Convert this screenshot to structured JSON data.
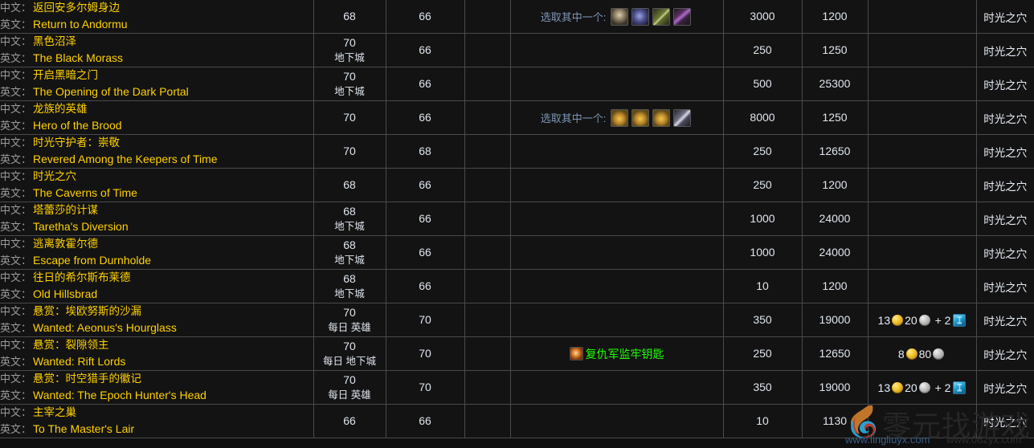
{
  "labels": {
    "chinese": "中文：",
    "english": "英文：",
    "choose_one": "选取其中一个:"
  },
  "rows": [
    {
      "name_zh": "返回安多尔姆身边",
      "name_en": "Return to Andormu",
      "quest_level": "68",
      "quest_tag": "",
      "required_level": "66",
      "item_required": "",
      "choose_one": true,
      "choice_icons": [
        "ic-a",
        "ic-b",
        "ic-c",
        "ic-d"
      ],
      "reputation": "3000",
      "experience": "1200",
      "money": null,
      "zone": "时光之穴"
    },
    {
      "name_zh": "黑色沼泽",
      "name_en": "The Black Morass",
      "quest_level": "70",
      "quest_tag": "地下城",
      "required_level": "66",
      "item_required": "",
      "choose_one": false,
      "choice_icons": [],
      "reputation": "250",
      "experience": "1250",
      "money": null,
      "zone": "时光之穴"
    },
    {
      "name_zh": "开启黑暗之门",
      "name_en": "The Opening of the Dark Portal",
      "quest_level": "70",
      "quest_tag": "地下城",
      "required_level": "66",
      "item_required": "",
      "choose_one": false,
      "choice_icons": [],
      "reputation": "500",
      "experience": "25300",
      "money": null,
      "zone": "时光之穴"
    },
    {
      "name_zh": "龙族的英雄",
      "name_en": "Hero of the Brood",
      "quest_level": "70",
      "quest_tag": "",
      "required_level": "66",
      "item_required": "",
      "choose_one": true,
      "choice_icons": [
        "ic-e",
        "ic-e",
        "ic-e",
        "ic-f"
      ],
      "reputation": "8000",
      "experience": "1250",
      "money": null,
      "zone": "时光之穴"
    },
    {
      "name_zh": "时光守护者：崇敬",
      "name_en": "Revered Among the Keepers of Time",
      "quest_level": "70",
      "quest_tag": "",
      "required_level": "68",
      "item_required": "",
      "choose_one": false,
      "choice_icons": [],
      "reputation": "250",
      "experience": "12650",
      "money": null,
      "zone": "时光之穴"
    },
    {
      "name_zh": "时光之穴",
      "name_en": "The Caverns of Time",
      "quest_level": "68",
      "quest_tag": "",
      "required_level": "66",
      "item_required": "",
      "choose_one": false,
      "choice_icons": [],
      "reputation": "250",
      "experience": "1200",
      "money": null,
      "zone": "时光之穴"
    },
    {
      "name_zh": "塔蕾莎的计谋",
      "name_en": "Taretha's Diversion",
      "quest_level": "68",
      "quest_tag": "地下城",
      "required_level": "66",
      "item_required": "",
      "choose_one": false,
      "choice_icons": [],
      "reputation": "1000",
      "experience": "24000",
      "money": null,
      "zone": "时光之穴"
    },
    {
      "name_zh": "逃离敦霍尔德",
      "name_en": "Escape from Durnholde",
      "quest_level": "68",
      "quest_tag": "地下城",
      "required_level": "66",
      "item_required": "",
      "choose_one": false,
      "choice_icons": [],
      "reputation": "1000",
      "experience": "24000",
      "money": null,
      "zone": "时光之穴"
    },
    {
      "name_zh": "往日的希尔斯布莱德",
      "name_en": "Old Hillsbrad",
      "quest_level": "68",
      "quest_tag": "地下城",
      "required_level": "66",
      "item_required": "",
      "choose_one": false,
      "choice_icons": [],
      "reputation": "10",
      "experience": "1200",
      "money": null,
      "zone": "时光之穴"
    },
    {
      "name_zh": "悬赏：埃欧努斯的沙漏",
      "name_en": "Wanted: Aeonus's Hourglass",
      "quest_level": "70",
      "quest_tag": "每日 英雄",
      "required_level": "70",
      "item_required": "",
      "choose_one": false,
      "choice_icons": [],
      "reputation": "350",
      "experience": "19000",
      "money": {
        "gold": "13",
        "silver": "20",
        "extra_count": "2",
        "extra_icon": "badge-icon"
      },
      "zone": "时光之穴"
    },
    {
      "name_zh": "悬赏：裂隙领主",
      "name_en": "Wanted: Rift Lords",
      "quest_level": "70",
      "quest_tag": "每日 地下城",
      "required_level": "70",
      "item_required": "复仇军监牢钥匙",
      "choose_one": false,
      "choice_icons": [],
      "reputation": "250",
      "experience": "12650",
      "money": {
        "gold": "8",
        "silver": "80",
        "extra_count": "",
        "extra_icon": ""
      },
      "zone": "时光之穴"
    },
    {
      "name_zh": "悬赏：时空猎手的徽记",
      "name_en": "Wanted: The Epoch Hunter's Head",
      "quest_level": "70",
      "quest_tag": "每日 英雄",
      "required_level": "70",
      "item_required": "",
      "choose_one": false,
      "choice_icons": [],
      "reputation": "350",
      "experience": "19000",
      "money": {
        "gold": "13",
        "silver": "20",
        "extra_count": "2",
        "extra_icon": "badge-icon"
      },
      "zone": "时光之穴"
    },
    {
      "name_zh": "主宰之巢",
      "name_en": "To The Master's Lair",
      "quest_level": "66",
      "quest_tag": "",
      "required_level": "66",
      "item_required": "",
      "choose_one": false,
      "choice_icons": [],
      "reputation": "10",
      "experience": "1130",
      "money": null,
      "zone": "时光之穴"
    }
  ],
  "watermark": {
    "characters": "零元找游戏",
    "url_left": "www.lingliuyx.com",
    "url_right": "www.06zyx.com"
  },
  "colors": {
    "quest_text": "#ffd100",
    "label_text": "#9a9a9a",
    "numeric_text": "#dfe5ee",
    "item_link_green": "#1eff00",
    "choose_label": "#7d95b5",
    "border": "#4a4a4a",
    "background": "#131313"
  }
}
